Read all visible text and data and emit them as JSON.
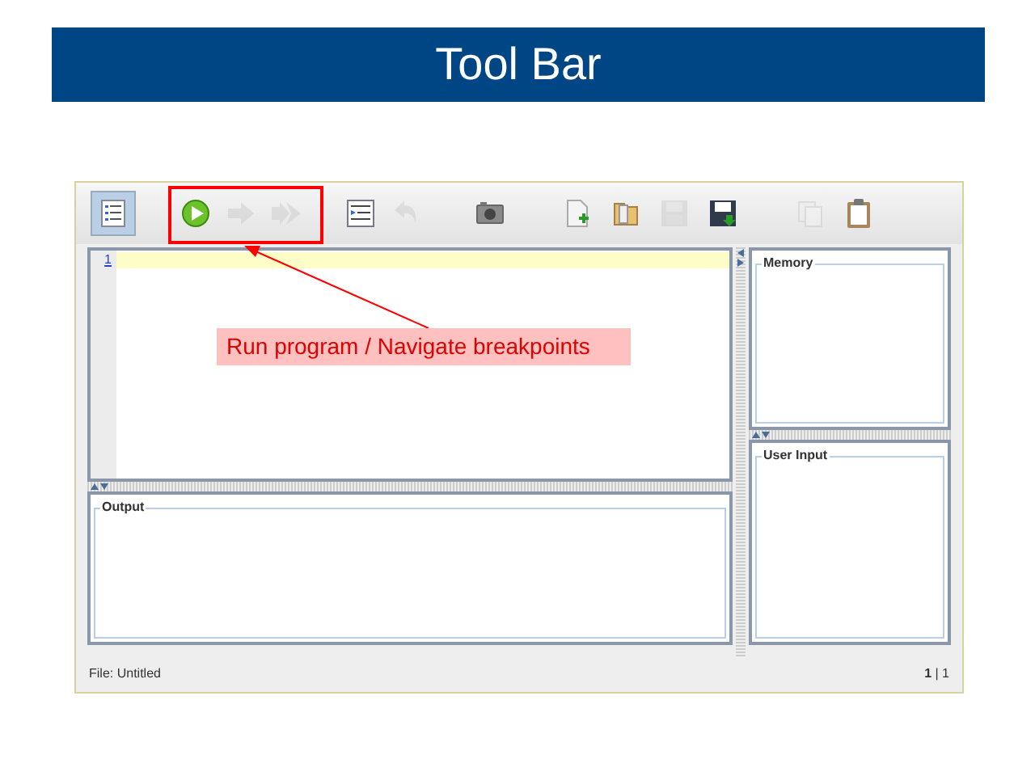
{
  "slide": {
    "title": "Tool Bar"
  },
  "toolbar": {
    "buttons": [
      {
        "kind": "line-numbers",
        "pressed": true,
        "disabled": false
      },
      {
        "kind": "run",
        "pressed": false,
        "disabled": false
      },
      {
        "kind": "step",
        "pressed": false,
        "disabled": true
      },
      {
        "kind": "step-all",
        "pressed": false,
        "disabled": true
      },
      {
        "kind": "indent",
        "pressed": false,
        "disabled": false
      },
      {
        "kind": "undo",
        "pressed": false,
        "disabled": true
      },
      {
        "kind": "camera",
        "pressed": false,
        "disabled": false
      },
      {
        "kind": "new-file",
        "pressed": false,
        "disabled": false
      },
      {
        "kind": "open",
        "pressed": false,
        "disabled": false
      },
      {
        "kind": "save",
        "pressed": false,
        "disabled": true
      },
      {
        "kind": "save-as",
        "pressed": false,
        "disabled": false
      },
      {
        "kind": "copy",
        "pressed": false,
        "disabled": true
      },
      {
        "kind": "paste",
        "pressed": false,
        "disabled": false
      }
    ]
  },
  "editor": {
    "line_numbers": [
      "1"
    ]
  },
  "panels": {
    "output": "Output",
    "memory": "Memory",
    "user_input": "User Input"
  },
  "status_bar": {
    "file": "File: Untitled",
    "position": "**1** | 1"
  },
  "annotation": {
    "text": "Run program / Navigate breakpoints"
  }
}
